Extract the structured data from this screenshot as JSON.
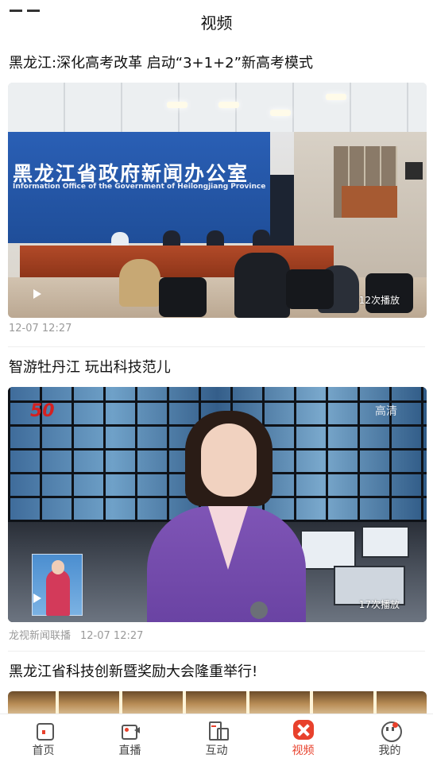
{
  "header": {
    "title": "视频"
  },
  "feed": {
    "items": [
      {
        "title": "黑龙江:深化高考改革 启动“3+1+2”新高考模式",
        "views": "12次播放",
        "source": "",
        "time": "12-07 12:27",
        "thumbnail": {
          "sign_cn": "黑龙江省政府新闻办公室",
          "sign_en": "Information Office of the Government of Heilongjiang Province"
        }
      },
      {
        "title": "智游牡丹江 玩出科技范儿",
        "views": "17次播放",
        "source": "龙视新闻联播",
        "time": "12-07 12:27",
        "thumbnail": {
          "logo": "50",
          "badge": "高清"
        }
      },
      {
        "title": "黑龙江省科技创新暨奖励大会隆重举行!"
      }
    ]
  },
  "tabbar": {
    "active_color": "#e8412c",
    "items": [
      {
        "label": "首页",
        "icon": "home-icon",
        "active": false
      },
      {
        "label": "直播",
        "icon": "live-camera-icon",
        "active": false
      },
      {
        "label": "互动",
        "icon": "interact-icon",
        "active": false
      },
      {
        "label": "视频",
        "icon": "video-icon",
        "active": true
      },
      {
        "label": "我的",
        "icon": "profile-icon",
        "active": false
      }
    ]
  }
}
